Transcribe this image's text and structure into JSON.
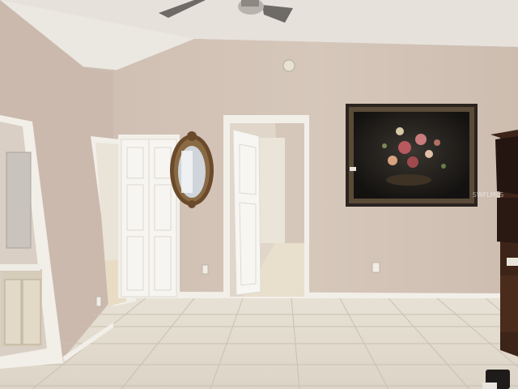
{
  "photo": {
    "subject": "empty-room-interior",
    "watermark": "SWFLMLS",
    "colors": {
      "wall": "#d4c4b8",
      "ceiling": "#e6e1db",
      "floor_tile": "#e2dccf",
      "door": "#f6f3ee",
      "trim": "#f2efe9",
      "frame": "#2b2420",
      "mirror_frame": "#6b4a2c",
      "furniture": "#3d2418"
    }
  }
}
